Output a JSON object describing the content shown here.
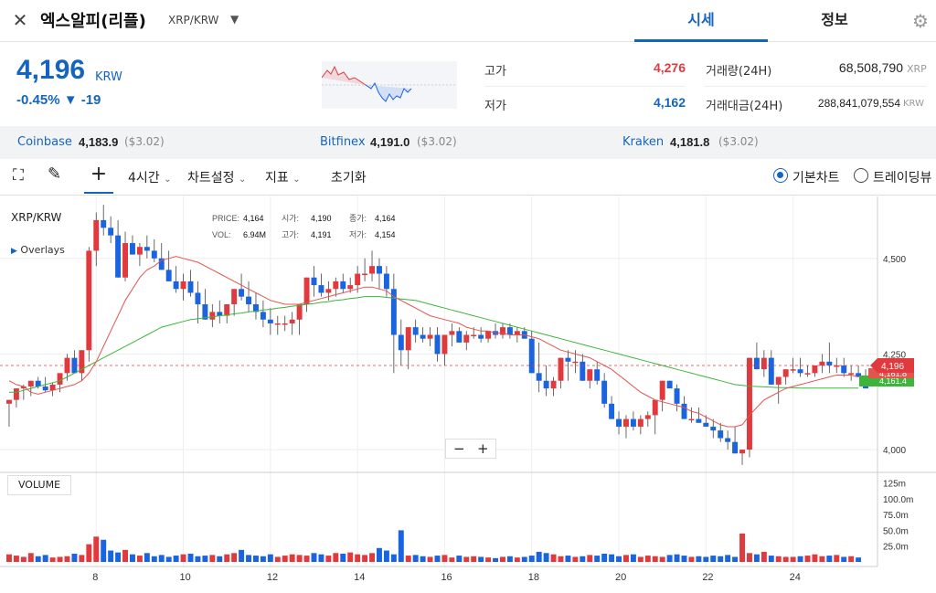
{
  "header": {
    "coin_name": "엑스알피(리플)",
    "pair": "XRP/KRW",
    "tabs": [
      {
        "label": "시세"
      },
      {
        "label": "정보"
      }
    ]
  },
  "price": {
    "value": "4,196",
    "unit": "KRW",
    "change_pct": "-0.45%",
    "change_abs": "▼ -19"
  },
  "stats": {
    "high_label": "고가",
    "high": "4,276",
    "low_label": "저가",
    "low": "4,162",
    "volume_label": "거래량(24H)",
    "volume": "68,508,790",
    "volume_unit": "XRP",
    "amount_label": "거래대금(24H)",
    "amount": "288,841,079,554",
    "amount_unit": "KRW"
  },
  "exchanges": [
    {
      "name": "Coinbase",
      "price": "4,183.9",
      "usd": "($3.02)"
    },
    {
      "name": "Bitfinex",
      "price": "4,191.0",
      "usd": "($3.02)"
    },
    {
      "name": "Kraken",
      "price": "4,181.8",
      "usd": "($3.02)"
    }
  ],
  "toolbar": {
    "interval": "4시간",
    "chart_settings": "차트설정",
    "indicators": "지표",
    "reset": "초기화",
    "view_basic": "기본차트",
    "view_trading": "트레이딩뷰"
  },
  "legend": {
    "pair": "XRP/KRW",
    "overlays": "Overlays",
    "price_label": "PRICE:",
    "price": "4,164",
    "open_label": "시가:",
    "open": "4,190",
    "close_label": "종가:",
    "close": "4,164",
    "vol_label": "VOL:",
    "vol": "6.94M",
    "high_label": "고가:",
    "high": "4,191",
    "low_label": "저가:",
    "low": "4,154"
  },
  "price_tag": {
    "current": "4,196",
    "ma_red": "4,161.8",
    "ma_green": "4,161.4"
  },
  "volume_label": "VOLUME",
  "colors": {
    "accent": "#1565c0",
    "up": "#e03a3e",
    "down": "#1a64e0",
    "ma_fast": "#e0564f",
    "ma_slow": "#3db53d"
  },
  "chart_data": {
    "type": "candlestick",
    "y_ticks": [
      "4,500",
      "4,250",
      "4,000"
    ],
    "ylim": [
      3950,
      4650
    ],
    "x_ticks": [
      "8",
      "10",
      "12",
      "14",
      "16",
      "18",
      "20",
      "22",
      "24"
    ],
    "vol_ticks": [
      "125m",
      "100.0m",
      "75.0m",
      "50.0m",
      "25.0m"
    ],
    "candles": [
      [
        4120,
        4130,
        4060
      ],
      [
        4130,
        4160,
        4110
      ],
      [
        4160,
        4170,
        4130
      ],
      [
        4165,
        4180,
        4140
      ],
      [
        4180,
        4190,
        4160
      ],
      [
        4165,
        4190,
        4150
      ],
      [
        4155,
        4175,
        4140
      ],
      [
        4170,
        4190,
        4150
      ],
      [
        4200,
        4250,
        4180
      ],
      [
        4240,
        4260,
        4200
      ],
      [
        4200,
        4260,
        4180
      ],
      [
        4260,
        4530,
        4230
      ],
      [
        4520,
        4620,
        4480
      ],
      [
        4600,
        4640,
        4560
      ],
      [
        4580,
        4610,
        4540
      ],
      [
        4560,
        4600,
        4500
      ],
      [
        4450,
        4570,
        4440
      ],
      [
        4540,
        4560,
        4510
      ],
      [
        4510,
        4540,
        4480
      ],
      [
        4530,
        4560,
        4500
      ],
      [
        4520,
        4550,
        4490
      ],
      [
        4500,
        4540,
        4470
      ],
      [
        4470,
        4520,
        4440
      ],
      [
        4440,
        4480,
        4410
      ],
      [
        4420,
        4460,
        4390
      ],
      [
        4440,
        4470,
        4400
      ],
      [
        4410,
        4440,
        4330
      ],
      [
        4380,
        4420,
        4340
      ],
      [
        4340,
        4380,
        4320
      ],
      [
        4360,
        4390,
        4330
      ],
      [
        4350,
        4380,
        4330
      ],
      [
        4380,
        4420,
        4350
      ],
      [
        4420,
        4460,
        4390
      ],
      [
        4400,
        4440,
        4360
      ],
      [
        4380,
        4410,
        4340
      ],
      [
        4360,
        4390,
        4320
      ],
      [
        4340,
        4370,
        4300
      ],
      [
        4330,
        4350,
        4300
      ],
      [
        4330,
        4350,
        4310
      ],
      [
        4330,
        4360,
        4300
      ],
      [
        4340,
        4380,
        4300
      ],
      [
        4380,
        4420,
        4360
      ],
      [
        4450,
        4480,
        4400
      ],
      [
        4430,
        4460,
        4400
      ],
      [
        4410,
        4440,
        4390
      ],
      [
        4420,
        4450,
        4400
      ],
      [
        4440,
        4460,
        4410
      ],
      [
        4420,
        4450,
        4410
      ],
      [
        4430,
        4480,
        4410
      ],
      [
        4460,
        4500,
        4440
      ],
      [
        4460,
        4520,
        4440
      ],
      [
        4480,
        4500,
        4420
      ],
      [
        4460,
        4480,
        4400
      ],
      [
        4420,
        4460,
        4200
      ],
      [
        4300,
        4340,
        4220
      ],
      [
        4260,
        4300,
        4210
      ],
      [
        4320,
        4340,
        4280
      ],
      [
        4300,
        4320,
        4280
      ],
      [
        4290,
        4320,
        4270
      ],
      [
        4300,
        4320,
        4230
      ],
      [
        4250,
        4280,
        4220
      ],
      [
        4300,
        4330,
        4270
      ],
      [
        4310,
        4320,
        4280
      ],
      [
        4280,
        4310,
        4260
      ],
      [
        4300,
        4320,
        4290
      ],
      [
        4300,
        4320,
        4280
      ],
      [
        4290,
        4310,
        4280
      ],
      [
        4310,
        4330,
        4290
      ],
      [
        4300,
        4330,
        4290
      ],
      [
        4320,
        4330,
        4290
      ],
      [
        4300,
        4320,
        4280
      ],
      [
        4310,
        4320,
        4300
      ],
      [
        4290,
        4310,
        4260
      ],
      [
        4200,
        4280,
        4150
      ],
      [
        4180,
        4220,
        4140
      ],
      [
        4160,
        4190,
        4140
      ],
      [
        4180,
        4200,
        4160
      ],
      [
        4240,
        4260,
        4180
      ],
      [
        4230,
        4260,
        4200
      ],
      [
        4230,
        4250,
        4180
      ],
      [
        4180,
        4210,
        4160
      ],
      [
        4210,
        4230,
        4170
      ],
      [
        4180,
        4200,
        4110
      ],
      [
        4120,
        4140,
        4080
      ],
      [
        4080,
        4100,
        4040
      ],
      [
        4060,
        4090,
        4030
      ],
      [
        4080,
        4100,
        4050
      ],
      [
        4060,
        4090,
        4040
      ],
      [
        4080,
        4100,
        4060
      ],
      [
        4090,
        4110,
        4040
      ],
      [
        4130,
        4160,
        4100
      ],
      [
        4180,
        4180,
        4160
      ],
      [
        4160,
        4170,
        4100
      ],
      [
        4120,
        4140,
        4080
      ],
      [
        4080,
        4110,
        4070
      ],
      [
        4080,
        4110,
        4070
      ],
      [
        4070,
        4090,
        4060
      ],
      [
        4060,
        4080,
        4030
      ],
      [
        4050,
        4070,
        4020
      ],
      [
        4030,
        4050,
        4000
      ],
      [
        4020,
        4060,
        3990
      ],
      [
        3990,
        4000,
        3960
      ],
      [
        4000,
        4220,
        3980
      ],
      [
        4240,
        4280,
        4220
      ],
      [
        4210,
        4260,
        4190
      ],
      [
        4240,
        4260,
        4190
      ],
      [
        4170,
        4190,
        4120
      ],
      [
        4190,
        4210,
        4170
      ],
      [
        4210,
        4240,
        4200
      ],
      [
        4210,
        4240,
        4190
      ],
      [
        4200,
        4220,
        4190
      ],
      [
        4200,
        4220,
        4190
      ],
      [
        4220,
        4250,
        4200
      ],
      [
        4230,
        4280,
        4200
      ],
      [
        4220,
        4240,
        4200
      ],
      [
        4220,
        4240,
        4190
      ],
      [
        4200,
        4220,
        4180
      ],
      [
        4200,
        4220,
        4190
      ],
      [
        4190,
        4210,
        4160
      ]
    ],
    "volumes": [
      12,
      10,
      8,
      14,
      9,
      11,
      7,
      8,
      9,
      13,
      11,
      28,
      40,
      35,
      18,
      15,
      19,
      12,
      10,
      14,
      9,
      11,
      8,
      10,
      12,
      13,
      9,
      10,
      11,
      9,
      12,
      14,
      19,
      11,
      10,
      9,
      12,
      8,
      10,
      12,
      11,
      10,
      14,
      12,
      10,
      14,
      13,
      15,
      12,
      11,
      14,
      22,
      18,
      12,
      50,
      10,
      11,
      9,
      8,
      10,
      11,
      7,
      10,
      8,
      9,
      8,
      7,
      6,
      8,
      9,
      7,
      8,
      10,
      16,
      14,
      12,
      9,
      10,
      8,
      9,
      11,
      10,
      13,
      12,
      9,
      11,
      12,
      8,
      10,
      9,
      8,
      11,
      12,
      10,
      8,
      9,
      8,
      10,
      9,
      11,
      8,
      45,
      14,
      12,
      16,
      10,
      9,
      8,
      8,
      9,
      10,
      12,
      9,
      10,
      11,
      8,
      9,
      7
    ],
    "ma_fast": [
      4180,
      4170,
      4165,
      4150,
      4145,
      4150,
      4155,
      4160,
      4165,
      4170,
      4180,
      4200,
      4230,
      4270,
      4310,
      4350,
      4390,
      4420,
      4450,
      4470,
      4480,
      4495,
      4500,
      4505,
      4500,
      4495,
      4490,
      4480,
      4470,
      4460,
      4450,
      4440,
      4430,
      4420,
      4410,
      4400,
      4390,
      4385,
      4380,
      4380,
      4380,
      4385,
      4390,
      4395,
      4400,
      4405,
      4410,
      4415,
      4420,
      4425,
      4425,
      4420,
      4415,
      4400,
      4390,
      4380,
      4370,
      4360,
      4350,
      4345,
      4340,
      4335,
      4330,
      4320,
      4315,
      4310,
      4310,
      4305,
      4305,
      4300,
      4300,
      4300,
      4295,
      4290,
      4280,
      4270,
      4260,
      4255,
      4250,
      4245,
      4240,
      4230,
      4220,
      4210,
      4195,
      4180,
      4165,
      4150,
      4140,
      4130,
      4125,
      4120,
      4115,
      4110,
      4100,
      4095,
      4085,
      4075,
      4065,
      4060,
      4060,
      4065,
      4090,
      4110,
      4130,
      4140,
      4150,
      4160,
      4165,
      4170,
      4175,
      4180,
      4185,
      4190,
      4195,
      4195,
      4195,
      4190
    ],
    "ma_slow": [
      4150,
      4150,
      4155,
      4160,
      4165,
      4170,
      4175,
      4180,
      4190,
      4200,
      4210,
      4220,
      4230,
      4240,
      4250,
      4260,
      4270,
      4280,
      4290,
      4300,
      4310,
      4320,
      4325,
      4330,
      4335,
      4340,
      4342,
      4345,
      4347,
      4350,
      4352,
      4355,
      4357,
      4360,
      4362,
      4365,
      4367,
      4370,
      4372,
      4375,
      4377,
      4380,
      4382,
      4385,
      4387,
      4390,
      4392,
      4395,
      4397,
      4400,
      4400,
      4400,
      4398,
      4396,
      4394,
      4392,
      4390,
      4385,
      4380,
      4375,
      4370,
      4365,
      4360,
      4355,
      4350,
      4345,
      4340,
      4335,
      4330,
      4325,
      4320,
      4315,
      4310,
      4305,
      4300,
      4295,
      4290,
      4285,
      4280,
      4275,
      4270,
      4265,
      4260,
      4255,
      4250,
      4245,
      4240,
      4235,
      4230,
      4225,
      4220,
      4215,
      4210,
      4205,
      4200,
      4195,
      4190,
      4185,
      4180,
      4175,
      4170,
      4168,
      4166,
      4165,
      4164,
      4163,
      4162,
      4162,
      4162,
      4161,
      4161,
      4161,
      4161,
      4161,
      4161,
      4161,
      4161,
      4161
    ]
  }
}
